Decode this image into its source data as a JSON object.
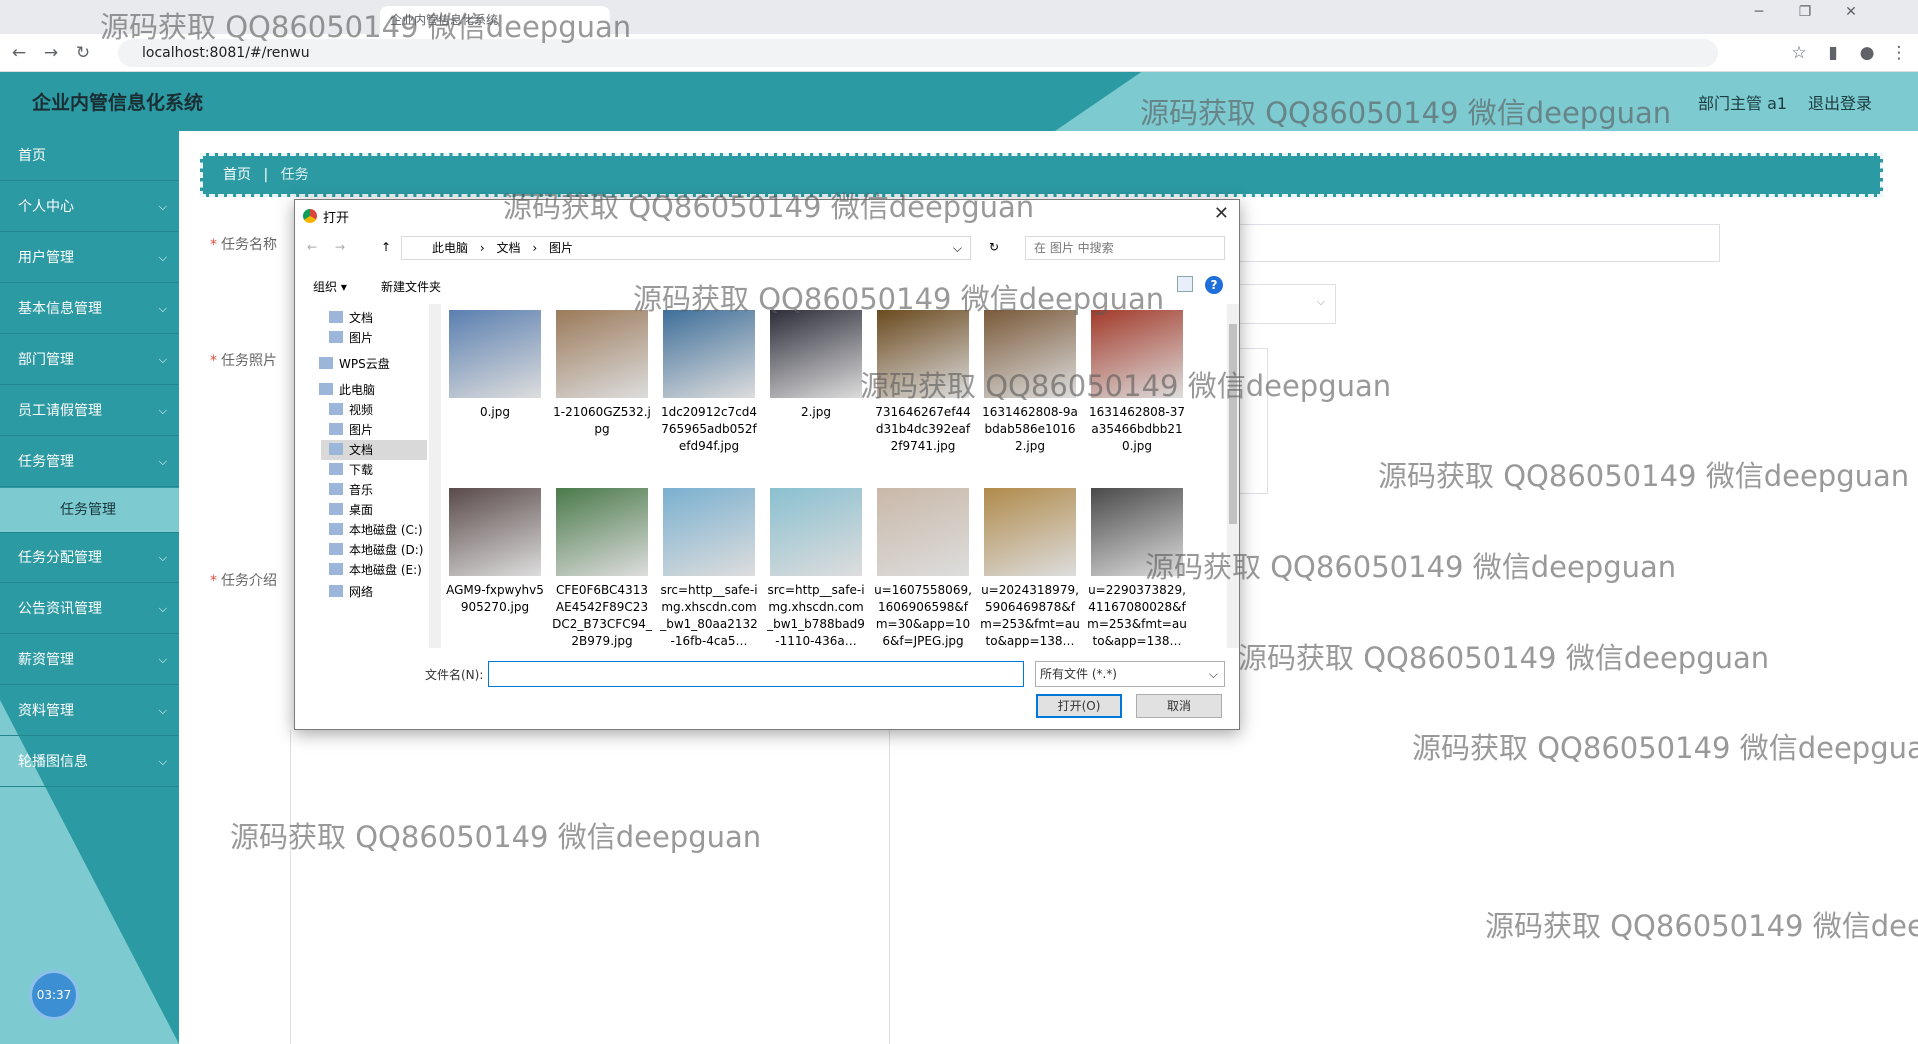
{
  "browser": {
    "tabs": [
      "企业内管信息化系统"
    ],
    "url": "localhost:8081/#/renwu"
  },
  "app": {
    "title": "企业内管信息化系统",
    "user": "部门主管 a1",
    "logout": "退出登录",
    "clock": "03:37"
  },
  "sidebar": {
    "items": [
      {
        "label": "首页",
        "has_arrow": false
      },
      {
        "label": "个人中心",
        "has_arrow": true
      },
      {
        "label": "用户管理",
        "has_arrow": true
      },
      {
        "label": "基本信息管理",
        "has_arrow": true
      },
      {
        "label": "部门管理",
        "has_arrow": true
      },
      {
        "label": "员工请假管理",
        "has_arrow": true
      },
      {
        "label": "任务管理",
        "has_arrow": true
      },
      {
        "label": "任务管理",
        "has_arrow": false,
        "sub": true
      },
      {
        "label": "任务分配管理",
        "has_arrow": true
      },
      {
        "label": "公告资讯管理",
        "has_arrow": true
      },
      {
        "label": "薪资管理",
        "has_arrow": true
      },
      {
        "label": "资料管理",
        "has_arrow": true
      },
      {
        "label": "轮播图信息",
        "has_arrow": true
      }
    ]
  },
  "breadcrumb": {
    "home": "首页",
    "current": "任务"
  },
  "form": {
    "name_label": "任务名称",
    "photo_label": "任务照片",
    "intro_label": "任务介绍"
  },
  "dialog": {
    "title": "打开",
    "path": [
      "此电脑",
      "文档",
      "图片"
    ],
    "search_placeholder": "在 图片 中搜索",
    "organize": "组织 ▾",
    "new_folder": "新建文件夹",
    "nav": [
      "文档",
      "图片",
      "WPS云盘",
      "此电脑",
      "视频",
      "图片",
      "文档",
      "下载",
      "音乐",
      "桌面",
      "本地磁盘 (C:)",
      "本地磁盘 (D:)",
      "本地磁盘 (E:)",
      "网络"
    ],
    "files": [
      "0.jpg",
      "1-21060GZ532.jpg",
      "1dc20912c7cd4765965adb052fefd94f.jpg",
      "2.jpg",
      "731646267ef44d31b4dc392eaf2f9741.jpg",
      "1631462808-9abdab586e10162.jpg",
      "1631462808-37a35466bdbb210.jpg",
      "AGM9-fxpwyhv5905270.jpg",
      "CFE0F6BC4313AE4542F89C23DC2_B73CFC94_2B979.jpg",
      "src=http__safe-img.xhscdn.com_bw1_80aa2132-16fb-4ca5…",
      "src=http__safe-img.xhscdn.com_bw1_b788bad9-1110-436a…",
      "u=1607558069,1606906598&fm=30&app=106&f=JPEG.jpg",
      "u=2024318979,5906469878&fm=253&fmt=auto&app=138…",
      "u=2290373829,41167080028&fm=253&fmt=auto&app=138…"
    ],
    "filename_label": "文件名(N):",
    "filename_value": "",
    "filetype": "所有文件 (*.*)",
    "open": "打开(O)",
    "cancel": "取消"
  },
  "watermark": "源码获取 QQ86050149 微信deepguan"
}
